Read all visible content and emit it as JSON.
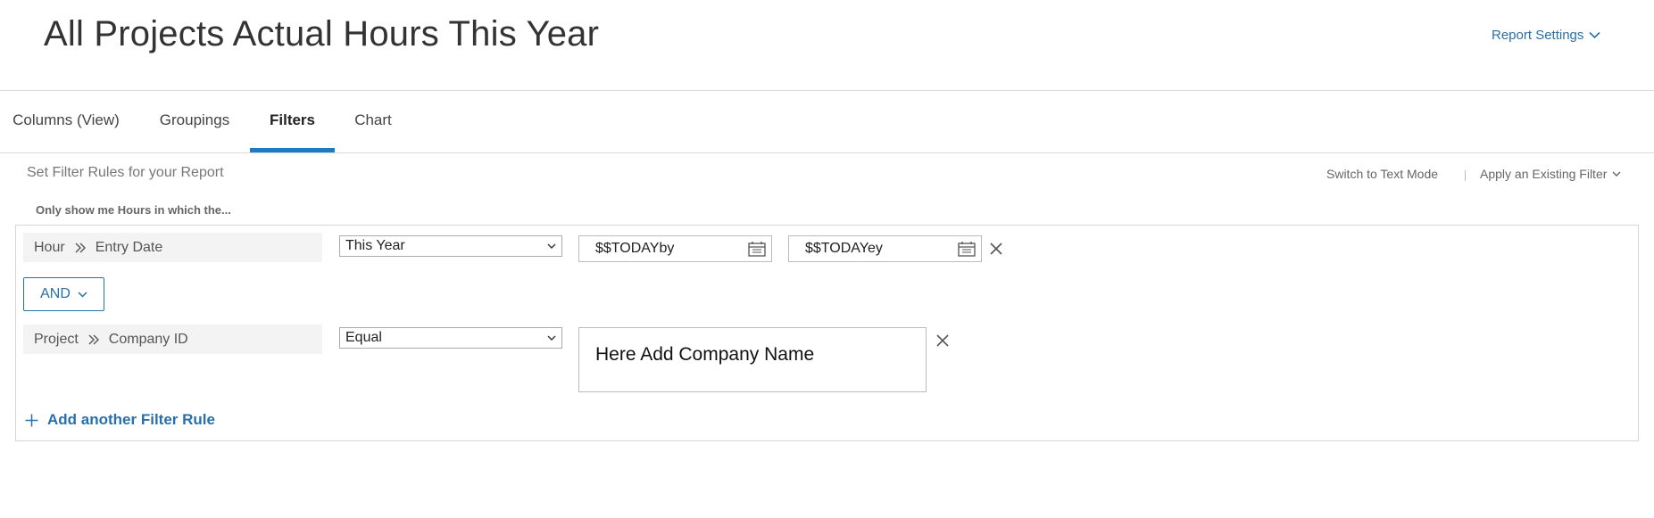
{
  "header": {
    "title": "All Projects Actual Hours This Year",
    "report_settings": "Report Settings"
  },
  "tabs": [
    {
      "label": "Columns (View)"
    },
    {
      "label": "Groupings"
    },
    {
      "label": "Filters",
      "active": true
    },
    {
      "label": "Chart"
    }
  ],
  "filters": {
    "subhead": "Set Filter Rules for your Report",
    "switch_text_mode": "Switch to Text Mode",
    "apply_existing": "Apply an Existing Filter",
    "only_show": "Only show me Hours in which the...",
    "rules": [
      {
        "object": "Hour",
        "field": "Entry Date",
        "operator": "This Year",
        "value1": "$$TODAYby",
        "value2": "$$TODAYey"
      },
      {
        "object": "Project",
        "field": "Company ID",
        "operator": "Equal",
        "value": "Here Add Company Name"
      }
    ],
    "connector": "AND",
    "add_rule": "Add another Filter Rule"
  },
  "colors": {
    "accent": "#2a6fa8",
    "tab_active": "#1b7cc2",
    "border": "#d6d6d6"
  }
}
